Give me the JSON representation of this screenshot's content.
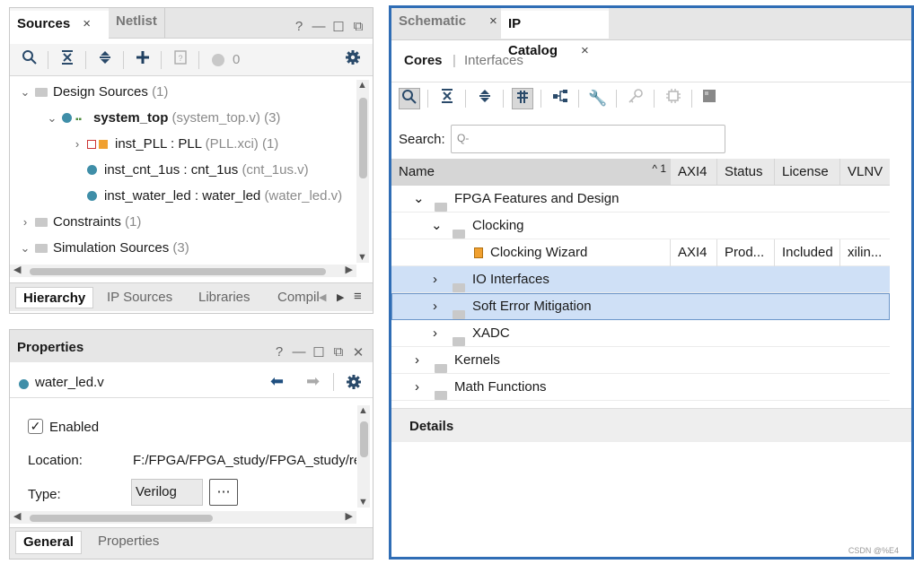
{
  "sources_panel": {
    "tabs": [
      {
        "label": "Sources",
        "close": "×"
      },
      {
        "label": "Netlist"
      }
    ],
    "window_buttons": [
      "?",
      "—",
      "☐",
      "⧉"
    ],
    "status_count": "0",
    "tree": [
      {
        "label": "Design Sources",
        "suffix": "(1)"
      },
      {
        "label": "system_top",
        "suffix": "(system_top.v) (3)"
      },
      {
        "label": "inst_PLL : PLL",
        "suffix": "(PLL.xci) (1)"
      },
      {
        "label": "inst_cnt_1us : cnt_1us",
        "suffix": "(cnt_1us.v)"
      },
      {
        "label": "inst_water_led : water_led",
        "suffix": "(water_led.v)"
      },
      {
        "label": "Constraints",
        "suffix": "(1)"
      },
      {
        "label": "Simulation Sources",
        "suffix": "(3)"
      }
    ],
    "bottom_tabs": [
      "Hierarchy",
      "IP Sources",
      "Libraries",
      "Compil"
    ]
  },
  "properties_panel": {
    "title": "Properties",
    "window_buttons": [
      "?",
      "—",
      "☐",
      "⧉",
      "✕"
    ],
    "file_name": "water_led.v",
    "enabled_label": "Enabled",
    "location_label": "Location:",
    "location_value": "F:/FPGA/FPGA_study/FPGA_study/re\\",
    "type_label": "Type:",
    "type_value": "Verilog",
    "more_button": "⋯",
    "bottom_tabs": [
      "General",
      "Properties"
    ]
  },
  "catalog_panel": {
    "tabs": [
      {
        "label": "Schematic",
        "close": "×"
      },
      {
        "label": "IP Catalog",
        "close": "×"
      }
    ],
    "subtabs": [
      "Cores",
      "Interfaces"
    ],
    "subtab_sep": "|",
    "search_label": "Search:",
    "search_placeholder": "Q-",
    "columns": [
      "Name",
      "AXI4",
      "Status",
      "License",
      "VLNV"
    ],
    "sort_indicator": "^ 1",
    "rows": [
      {
        "name": "FPGA Features and Design",
        "axi4": "",
        "status": "",
        "license": "",
        "vlnv": ""
      },
      {
        "name": "Clocking",
        "axi4": "",
        "status": "",
        "license": "",
        "vlnv": ""
      },
      {
        "name": "Clocking Wizard",
        "axi4": "AXI4",
        "status": "Prod...",
        "license": "Included",
        "vlnv": "xilin..."
      },
      {
        "name": "IO Interfaces",
        "axi4": "",
        "status": "",
        "license": "",
        "vlnv": ""
      },
      {
        "name": "Soft Error Mitigation",
        "axi4": "",
        "status": "",
        "license": "",
        "vlnv": ""
      },
      {
        "name": "XADC",
        "axi4": "",
        "status": "",
        "license": "",
        "vlnv": ""
      },
      {
        "name": "Kernels",
        "axi4": "",
        "status": "",
        "license": "",
        "vlnv": ""
      },
      {
        "name": "Math Functions",
        "axi4": "",
        "status": "",
        "license": "",
        "vlnv": ""
      }
    ],
    "details_title": "Details",
    "watermark": "CSDN @%E4"
  },
  "colors": {
    "accent": "#3f8ea8",
    "selection": "#cfe0f6",
    "frame": "#2f6db5"
  }
}
